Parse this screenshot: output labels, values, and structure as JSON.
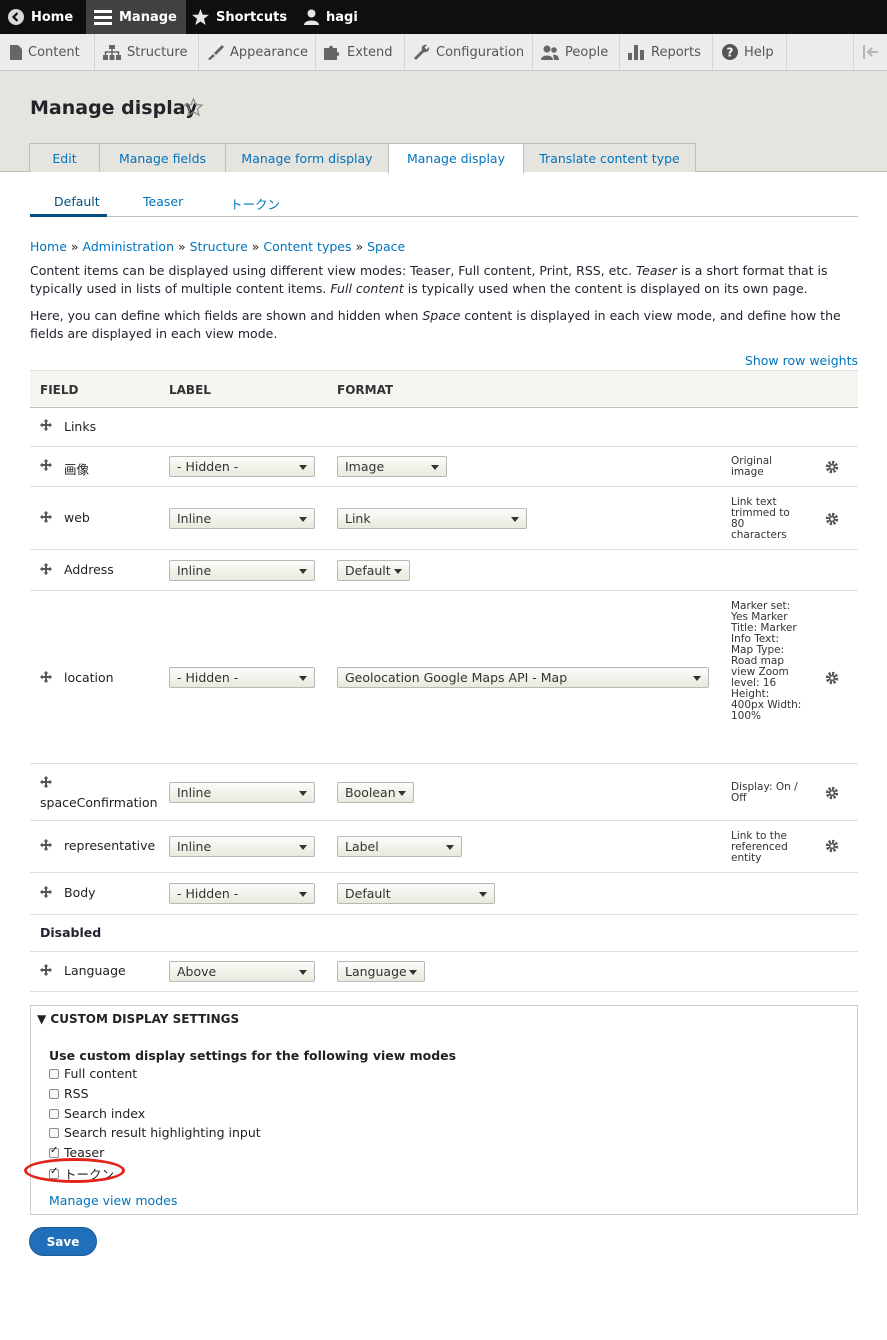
{
  "toolbar": {
    "home": "Home",
    "manage": "Manage",
    "shortcuts": "Shortcuts",
    "user": "hagi"
  },
  "tray": {
    "content": "Content",
    "structure": "Structure",
    "appearance": "Appearance",
    "extend": "Extend",
    "configuration": "Configuration",
    "people": "People",
    "reports": "Reports",
    "help": "Help"
  },
  "page": {
    "title": "Manage display"
  },
  "primary_tabs": [
    "Edit",
    "Manage fields",
    "Manage form display",
    "Manage display",
    "Translate content type"
  ],
  "secondary_tabs": [
    "Default",
    "Teaser",
    "トークン"
  ],
  "breadcrumb": [
    "Home",
    "Administration",
    "Structure",
    "Content types",
    "Space"
  ],
  "intro": {
    "p1_a": "Content items can be displayed using different view modes: Teaser, Full content, Print, RSS, etc. ",
    "p1_b": "Teaser",
    "p1_c": " is a short format that is typically used in lists of multiple content items. ",
    "p1_d": "Full content",
    "p1_e": " is typically used when the content is displayed on its own page.",
    "p2_a": "Here, you can define which fields are shown and hidden when ",
    "p2_b": "Space",
    "p2_c": " content is displayed in each view mode, and define how the fields are displayed in each view mode."
  },
  "show_row_weights": "Show row weights",
  "table": {
    "headers": {
      "field": "FIELD",
      "label": "LABEL",
      "format": "FORMAT"
    },
    "rows": [
      {
        "field": "Links",
        "label": "",
        "format": "",
        "summary": ""
      },
      {
        "field": "画像",
        "label": "- Hidden -",
        "format": "Image",
        "summary": "Original image"
      },
      {
        "field": "web",
        "label": "Inline",
        "format": "Link",
        "summary": "Link text trimmed to 80 characters"
      },
      {
        "field": "Address",
        "label": "Inline",
        "format": "Default",
        "summary": ""
      },
      {
        "field": "location",
        "label": "- Hidden -",
        "format": "Geolocation Google Maps API - Map",
        "summary": "Marker set: Yes Marker Title: Marker Info Text: Map Type: Road map view Zoom level: 16 Height: 400px Width: 100%"
      },
      {
        "field": "spaceConfirmation",
        "label": "Inline",
        "format": "Boolean",
        "summary": "Display: On / Off"
      },
      {
        "field": "representative",
        "label": "Inline",
        "format": "Label",
        "summary": "Link to the referenced entity"
      },
      {
        "field": "Body",
        "label": "- Hidden -",
        "format": "Default",
        "summary": ""
      }
    ],
    "disabled_label": "Disabled",
    "disabled_rows": [
      {
        "field": "Language",
        "label": "Above",
        "format": "Language",
        "summary": ""
      }
    ]
  },
  "custom_display": {
    "summary": "CUSTOM DISPLAY SETTINGS",
    "title": "Use custom display settings for the following view modes",
    "options": [
      {
        "label": "Full content",
        "checked": false
      },
      {
        "label": "RSS",
        "checked": false
      },
      {
        "label": "Search index",
        "checked": false
      },
      {
        "label": "Search result highlighting input",
        "checked": false
      },
      {
        "label": "Teaser",
        "checked": true
      },
      {
        "label": "トークン",
        "checked": true
      }
    ],
    "manage_link": "Manage view modes"
  },
  "save_label": "Save",
  "colors": {
    "link": "#0074bd",
    "toolbar": "#0f0f0f",
    "primary_button": "#1f6fbb",
    "highlight": "#e2231a"
  }
}
